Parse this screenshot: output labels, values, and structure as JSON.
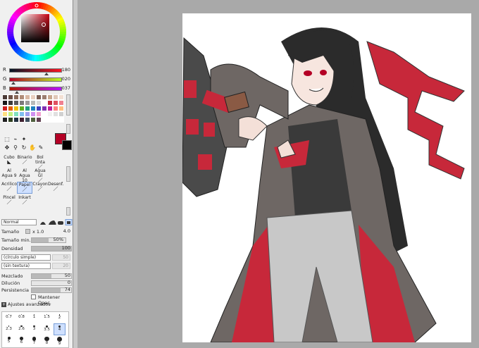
{
  "colors": {
    "current": "#b40025",
    "fg": "#b40025",
    "bg": "#000000"
  },
  "rgb": {
    "r_label": "R",
    "r_value": "180",
    "r_level": 0.706,
    "g_label": "G",
    "g_value": "020",
    "g_level": 0.078,
    "b_label": "B",
    "b_value": "037",
    "b_level": 0.145
  },
  "brushes": {
    "b0": "Cubo",
    "b1": "Binario",
    "b2": "Bol tinta",
    "b3": "Al Agua 9",
    "b4": "Al Agua 10",
    "b5": "Agua Gl",
    "b6": "Acrilico",
    "b7": "Papel",
    "b8": "Crayon",
    "b9": "Desenf.",
    "b10": "Pincel",
    "b11": "Inkart"
  },
  "blend_mode": "Normal",
  "props": {
    "size_label": "Tamaño",
    "size_mult": "x 1.0",
    "size_value": "4.0",
    "min_size_label": "Tamaño min.",
    "min_size_value": "50%",
    "min_size_level": 0.5,
    "density_label": "Densidad",
    "density_value": "100",
    "density_level": 1.0,
    "shape": "(círculo simple)",
    "shape_value": "50",
    "texture": "(sin textura)",
    "texture_value": "20",
    "blend_label": "Mezclado",
    "blend_value": "50",
    "blend_level": 0.5,
    "dilution_label": "Dilución",
    "dilution_value": "0",
    "dilution_level": 0,
    "persist_label": "Persistencia",
    "persist_value": "74",
    "persist_level": 0.74,
    "keep_opacity": "Mantener Opac.",
    "advanced": "Ajustes avanzados"
  },
  "brush_sizes": [
    "0.7",
    "0.8",
    "1",
    "1.5",
    "2",
    "2.3",
    "2.6",
    "3",
    "3.5",
    "4",
    "5",
    "6",
    "7",
    "8",
    "9"
  ],
  "selected_size": "4"
}
